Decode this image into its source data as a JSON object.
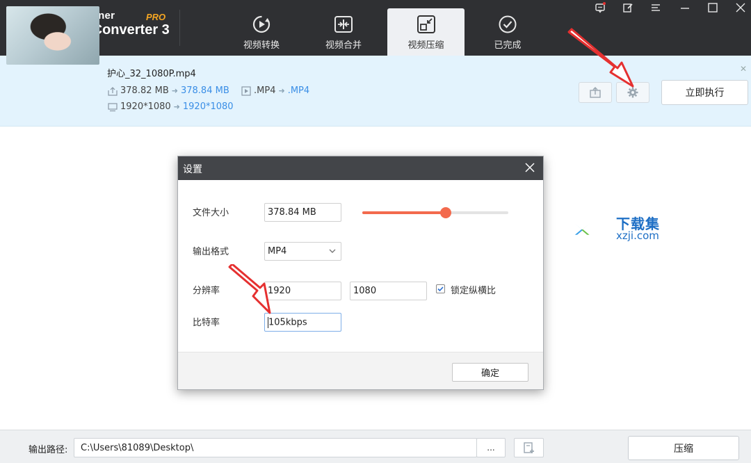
{
  "app": {
    "brand_line1": "WiseCleaner",
    "brand_line2": "Video Converter 3",
    "pro_badge": "PRO"
  },
  "tabs": [
    {
      "label": "视频转换",
      "icon": "convert-icon",
      "active": false
    },
    {
      "label": "视频合并",
      "icon": "merge-icon",
      "active": false
    },
    {
      "label": "视频压缩",
      "icon": "compress-icon",
      "active": true
    },
    {
      "label": "已完成",
      "icon": "check-circle-icon",
      "active": false
    }
  ],
  "file": {
    "name": "护心_32_1080P.mp4",
    "size_from": "378.82 MB",
    "size_to": "378.84 MB",
    "format_from": ".MP4",
    "format_to": ".MP4",
    "res_from": "1920*1080",
    "res_to": "1920*1080",
    "run_label": "立即执行"
  },
  "dialog": {
    "title": "设置",
    "file_size_label": "文件大小",
    "file_size_value": "378.84 MB",
    "file_size_slider_fraction": 0.57,
    "format_label": "输出格式",
    "format_value": "MP4",
    "resolution_label": "分辨率",
    "width_value": "1920",
    "height_value": "1080",
    "lock_ratio_label": "锁定纵横比",
    "lock_ratio_checked": true,
    "bitrate_label": "比特率",
    "bitrate_value": "105kbps",
    "ok_label": "确定"
  },
  "watermark": {
    "line1": "下载集",
    "line2": "xzji.com"
  },
  "bottom": {
    "output_label": "输出路径:",
    "output_path": "C:\\Users\\81089\\Desktop\\",
    "browse_label": "...",
    "compress_label": "压缩"
  },
  "colors": {
    "header_bg": "#2f3033",
    "accent_orange": "#f36a4d",
    "link_blue": "#3a8ee6",
    "file_row_bg": "#e3f3fd",
    "annotation_red": "#e53030"
  }
}
